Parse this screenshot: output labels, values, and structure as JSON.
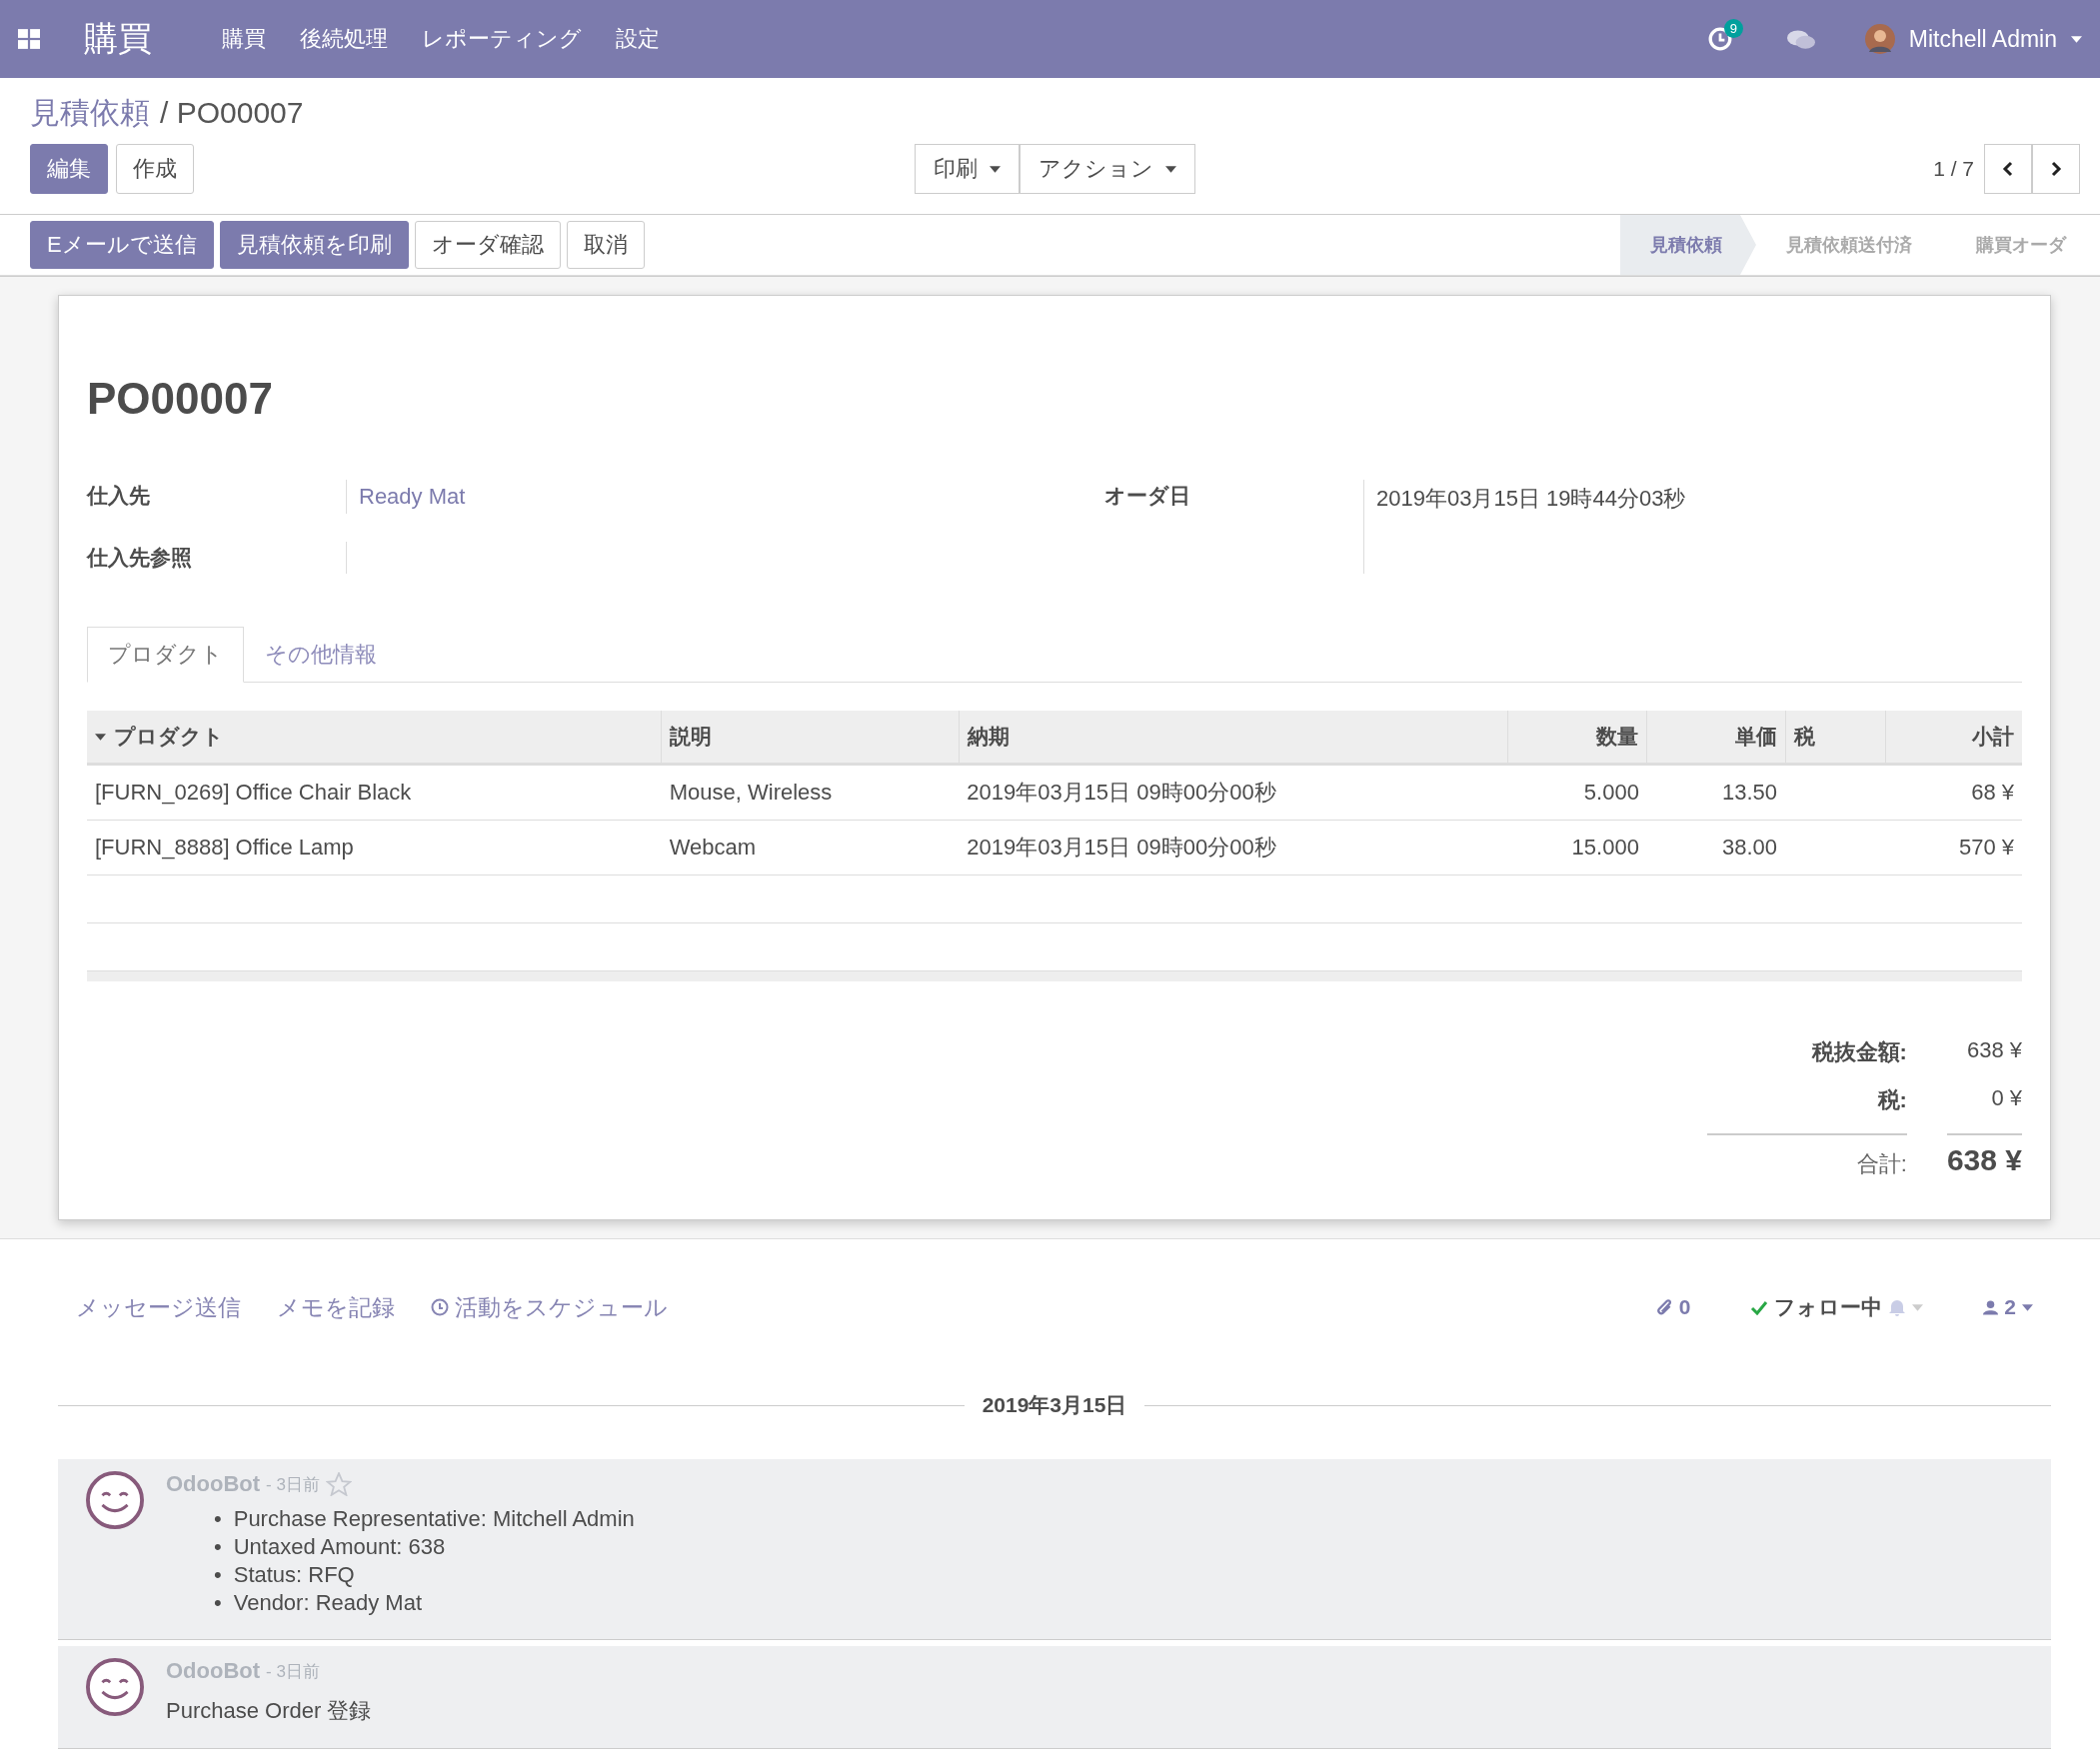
{
  "navbar": {
    "app_title": "購買",
    "menus": [
      "購買",
      "後続処理",
      "レポーティング",
      "設定"
    ],
    "activity_count": "9",
    "user_name": "Mitchell Admin"
  },
  "breadcrumb": {
    "parent": "見積依頼",
    "current": "/ PO00007"
  },
  "main_buttons": [
    {
      "label": "編集",
      "primary": true
    },
    {
      "label": "作成",
      "primary": false
    }
  ],
  "dropdowns": [
    "印刷",
    "アクション"
  ],
  "pager": "1 / 7",
  "header_buttons": [
    {
      "label": "Eメールで送信",
      "primary": true
    },
    {
      "label": "見積依頼を印刷",
      "primary": true
    },
    {
      "label": "オーダ確認",
      "primary": false
    },
    {
      "label": "取消",
      "primary": false
    }
  ],
  "stages": [
    {
      "label": "見積依頼",
      "selected": true
    },
    {
      "label": "見積依頼送付済",
      "selected": false
    },
    {
      "label": "購買オーダ",
      "selected": false
    }
  ],
  "title": "PO00007",
  "fields_left": [
    {
      "label": "仕入先",
      "value": "Ready Mat"
    },
    {
      "label": "仕入先参照"
    }
  ],
  "fields_right": [
    {
      "label": "オーダ日",
      "value": "2019年03月15日 19時44分03秒"
    }
  ],
  "tabs": [
    {
      "label": "プロダクト",
      "selected": true
    },
    {
      "label": "その他情報",
      "selected": false
    }
  ],
  "table": {
    "columns": [
      {
        "label": "プロダクト",
        "numeric": false
      },
      {
        "label": "説明",
        "numeric": false
      },
      {
        "label": "納期",
        "numeric": false
      },
      {
        "label": "数量",
        "numeric": true
      },
      {
        "label": "単価",
        "numeric": true
      },
      {
        "label": "税",
        "numeric": false
      },
      {
        "label": "小計",
        "numeric": true
      }
    ],
    "rows": [
      [
        "[FURN_0269] Office Chair Black",
        "Mouse, Wireless",
        "2019年03月15日 09時00分00秒",
        "5.000",
        "13.50",
        "",
        "68 ¥"
      ],
      [
        "[FURN_8888] Office Lamp",
        "Webcam",
        "2019年03月15日 09時00分00秒",
        "15.000",
        "38.00",
        "",
        "570 ¥"
      ]
    ]
  },
  "totals": [
    {
      "label": "税抜金額:",
      "value": "638 ¥",
      "kind": "line"
    },
    {
      "label": "税:",
      "value": "0 ¥",
      "kind": "line"
    },
    {
      "label": "合計:",
      "value": "638 ¥",
      "kind": "total"
    }
  ],
  "chatter": {
    "actions": [
      "メッセージ送信",
      "メモを記録",
      "活動をスケジュール"
    ],
    "attachments": "0",
    "follow": "フォロー中",
    "followers": "2",
    "date": "2019年3月15日",
    "messages": [
      {
        "kind": "tracking",
        "author": "OdooBot",
        "time": "- 3日前",
        "bullet": "•",
        "items": [
          "Purchase Representative: Mitchell Admin",
          "Untaxed Amount: 638",
          "Status: RFQ",
          "Vendor: Ready Mat"
        ]
      },
      {
        "kind": "note",
        "author": "OdooBot",
        "time": "- 3日前",
        "body": "Purchase Order 登録"
      }
    ]
  }
}
